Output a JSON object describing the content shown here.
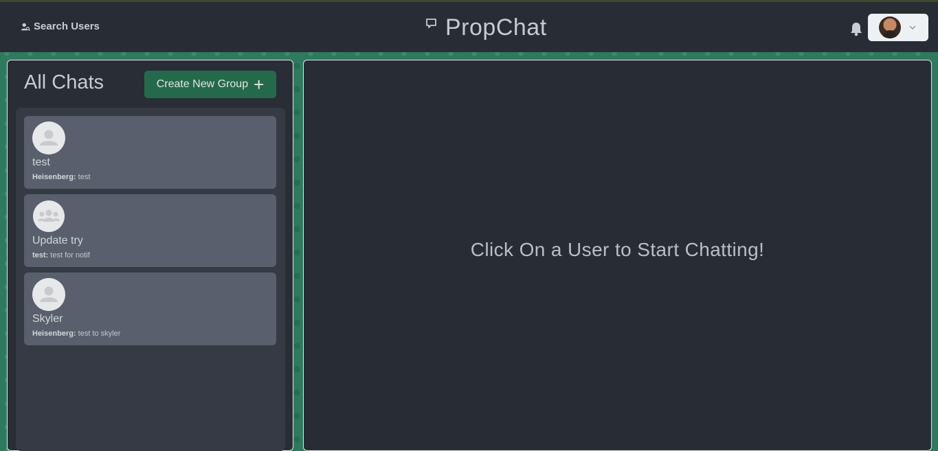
{
  "header": {
    "search_label": "Search Users",
    "brand_title": "PropChat"
  },
  "sidebar": {
    "title": "All Chats",
    "create_group_label": "Create New Group",
    "create_group_plus": "+",
    "chats": [
      {
        "name": "test",
        "sender": "Heisenberg:",
        "message": "test",
        "avatar": "user-icon"
      },
      {
        "name": "Update try",
        "sender": "test:",
        "message": "test for notif",
        "avatar": "group-icon"
      },
      {
        "name": "Skyler",
        "sender": "Heisenberg:",
        "message": "test to skyler",
        "avatar": "user-icon"
      }
    ]
  },
  "main": {
    "empty_message": "Click On a User to Start Chatting!"
  },
  "colors": {
    "header_bg": "#282c35",
    "accent_green": "#25694b",
    "chat_item_bg": "#5a5f6d"
  }
}
